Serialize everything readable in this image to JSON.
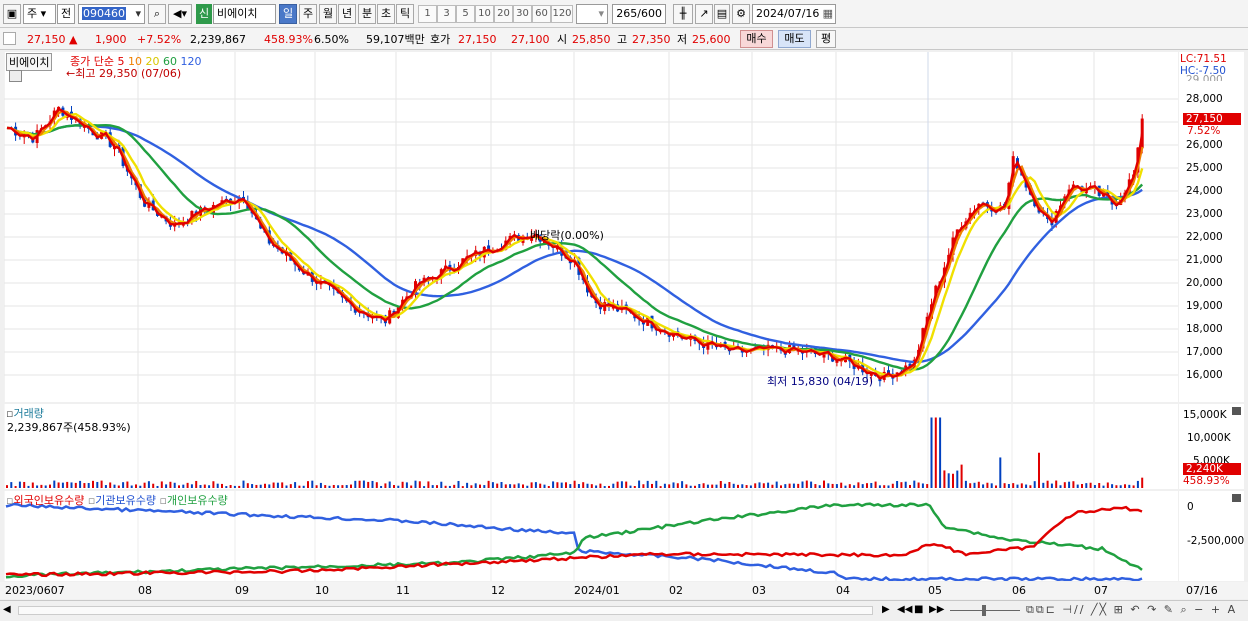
{
  "toolbar": {
    "market": "주",
    "prev": "전",
    "code": "090460",
    "badge": "신",
    "name": "비에이치",
    "period_day": "일",
    "period_week": "주",
    "period_month": "월",
    "period_year": "년",
    "period_min": "분",
    "period_sec": "초",
    "period_tick": "틱",
    "intervals": [
      "1",
      "3",
      "5",
      "10",
      "20",
      "30",
      "60",
      "120"
    ],
    "count": "265",
    "count_max": "/600",
    "date": "2024/07/16"
  },
  "quote": {
    "price": "27,150",
    "arrow": "▲",
    "change": "1,900",
    "pct": "+7.52%",
    "volume": "2,239,867",
    "vol_ratio": "458.93%",
    "turnover": "6.50%",
    "amount": "59,107백만",
    "bid_label": "호가",
    "ask": "27,150",
    "bid": "27,100",
    "open_label": "시",
    "open": "25,850",
    "high_label": "고",
    "high": "27,350",
    "low_label": "저",
    "low": "25,600",
    "buy": "매수",
    "sell": "매도",
    "eval": "평"
  },
  "price_pane": {
    "stock_tag": "비에이치",
    "ma_label": "종가 단순",
    "ma": [
      "5",
      "10",
      "20",
      "60",
      "120"
    ],
    "max_note": "←최고 29,350 (07/06)",
    "min_note": "최저 15,830 (04/19)",
    "div_note": "배당락(0.00%)",
    "lc": "LC:71.51",
    "hc": "HC:-7.50",
    "price_badge": "27,150",
    "pct_badge": "7.52%",
    "y_ticks": [
      "28,000",
      "27,000",
      "26,000",
      "25,000",
      "24,000",
      "23,000",
      "22,000",
      "21,000",
      "20,000",
      "19,000",
      "18,000",
      "17,000",
      "16,000"
    ],
    "top_tick": "29,000"
  },
  "volume_pane": {
    "title": "거래량",
    "value": "2,239,867주(458.93%)",
    "y_ticks": [
      "15,000K",
      "10,000K",
      "5,000K"
    ],
    "badge": "2,240K",
    "badge_pct": "458.93%"
  },
  "holding_pane": {
    "legend": [
      "외국인보유수량",
      "기관보유수량",
      "개인보유수량"
    ],
    "y_ticks": [
      "0",
      "-2,500,000"
    ]
  },
  "x_axis": {
    "labels": [
      "2023/06",
      "07",
      "08",
      "09",
      "10",
      "11",
      "12",
      "2024/01",
      "02",
      "03",
      "04",
      "05",
      "06",
      "07"
    ],
    "last_date": "07/16"
  },
  "colors": {
    "up": "#e00000",
    "down": "#0040c0",
    "ma5": "#e00000",
    "ma10": "#f08000",
    "ma20": "#f0e000",
    "ma60": "#20a040",
    "ma120": "#3060e0"
  }
}
